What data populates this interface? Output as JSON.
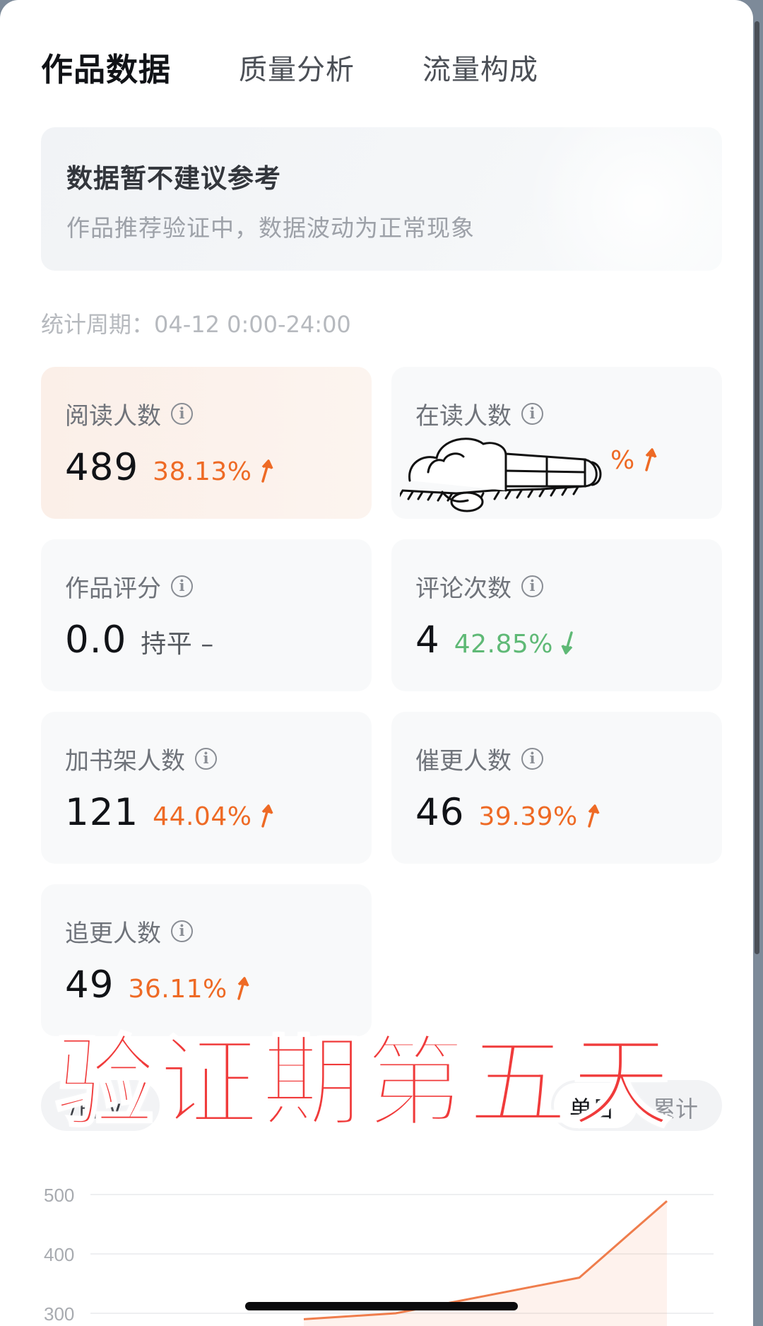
{
  "tabs": [
    {
      "label": "作品数据",
      "active": true
    },
    {
      "label": "质量分析",
      "active": false
    },
    {
      "label": "流量构成",
      "active": false
    }
  ],
  "notice": {
    "title": "数据暂不建议参考",
    "subtitle": "作品推荐验证中，数据波动为正常现象"
  },
  "period": "统计周期：04-12 0:00-24:00",
  "metrics": [
    {
      "label": "阅读人数",
      "value": "489",
      "change": "38.13%",
      "trend": "up"
    },
    {
      "label": "在读人数",
      "value": "",
      "change": "%",
      "trend": "up"
    },
    {
      "label": "作品评分",
      "value": "0.0",
      "change": "持平 –",
      "trend": "flat"
    },
    {
      "label": "评论次数",
      "value": "4",
      "change": "42.85%",
      "trend": "down"
    },
    {
      "label": "加书架人数",
      "value": "121",
      "change": "44.04%",
      "trend": "up"
    },
    {
      "label": "催更人数",
      "value": "46",
      "change": "39.39%",
      "trend": "up"
    },
    {
      "label": "追更人数",
      "value": "49",
      "change": "36.11%",
      "trend": "up"
    }
  ],
  "info_icon_glyph": "i",
  "overlay_text": "验证期第五天",
  "toolbar": {
    "left_label": "/日 ∨",
    "options": [
      "单日",
      "累计"
    ]
  },
  "colors": {
    "up": "#ee6a25",
    "down": "#5fb976",
    "accent": "#f03b3b"
  },
  "chart_data": {
    "type": "area",
    "ylim": [
      200,
      500
    ],
    "y_ticks": [
      500,
      400,
      300
    ],
    "series": [
      {
        "values": [
          290,
          300,
          330,
          360,
          489
        ]
      }
    ]
  }
}
